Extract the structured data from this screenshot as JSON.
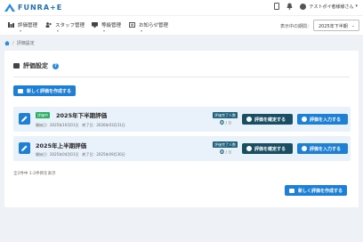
{
  "header": {
    "logo_text": "FUNRA+E",
    "user_name": "テストポイ者様様さん",
    "nav": [
      {
        "label": "評価管理"
      },
      {
        "label": "スタッフ管理"
      },
      {
        "label": "等級管理"
      },
      {
        "label": "お知らせ管理"
      }
    ],
    "period_label": "表示中の期間：",
    "period_value": "2025年下半期"
  },
  "breadcrumb": {
    "current": "評価設定"
  },
  "page": {
    "title": "評価設定",
    "help_symbol": "?",
    "new_button_label": "新しく評価を作成する",
    "count_text": "全2件中 1-2件目を表示"
  },
  "periods": [
    {
      "badge": "評価中",
      "title": "2025年下半期評価",
      "dates": "開始日：2025年10月01日　終了日：2026年03月31日",
      "done_label": "評価完了人数",
      "done_count": "0",
      "total": "0",
      "decide_label": "評価を確定する",
      "input_label": "評価を入力する"
    },
    {
      "badge": "",
      "title": "2025年上半期評価",
      "dates": "開始日：2025年04月01日　終了日：2025年09月30日",
      "done_label": "評価完了人数",
      "done_count": "0",
      "total": "0",
      "decide_label": "評価を確定する",
      "input_label": "評価を入力する"
    }
  ],
  "colors": {
    "primary": "#1e7fd6",
    "dark_teal": "#1a4f63",
    "active_green": "#27ae60",
    "row_bg": "#e9f2fb",
    "page_bg": "#eef2f7"
  }
}
